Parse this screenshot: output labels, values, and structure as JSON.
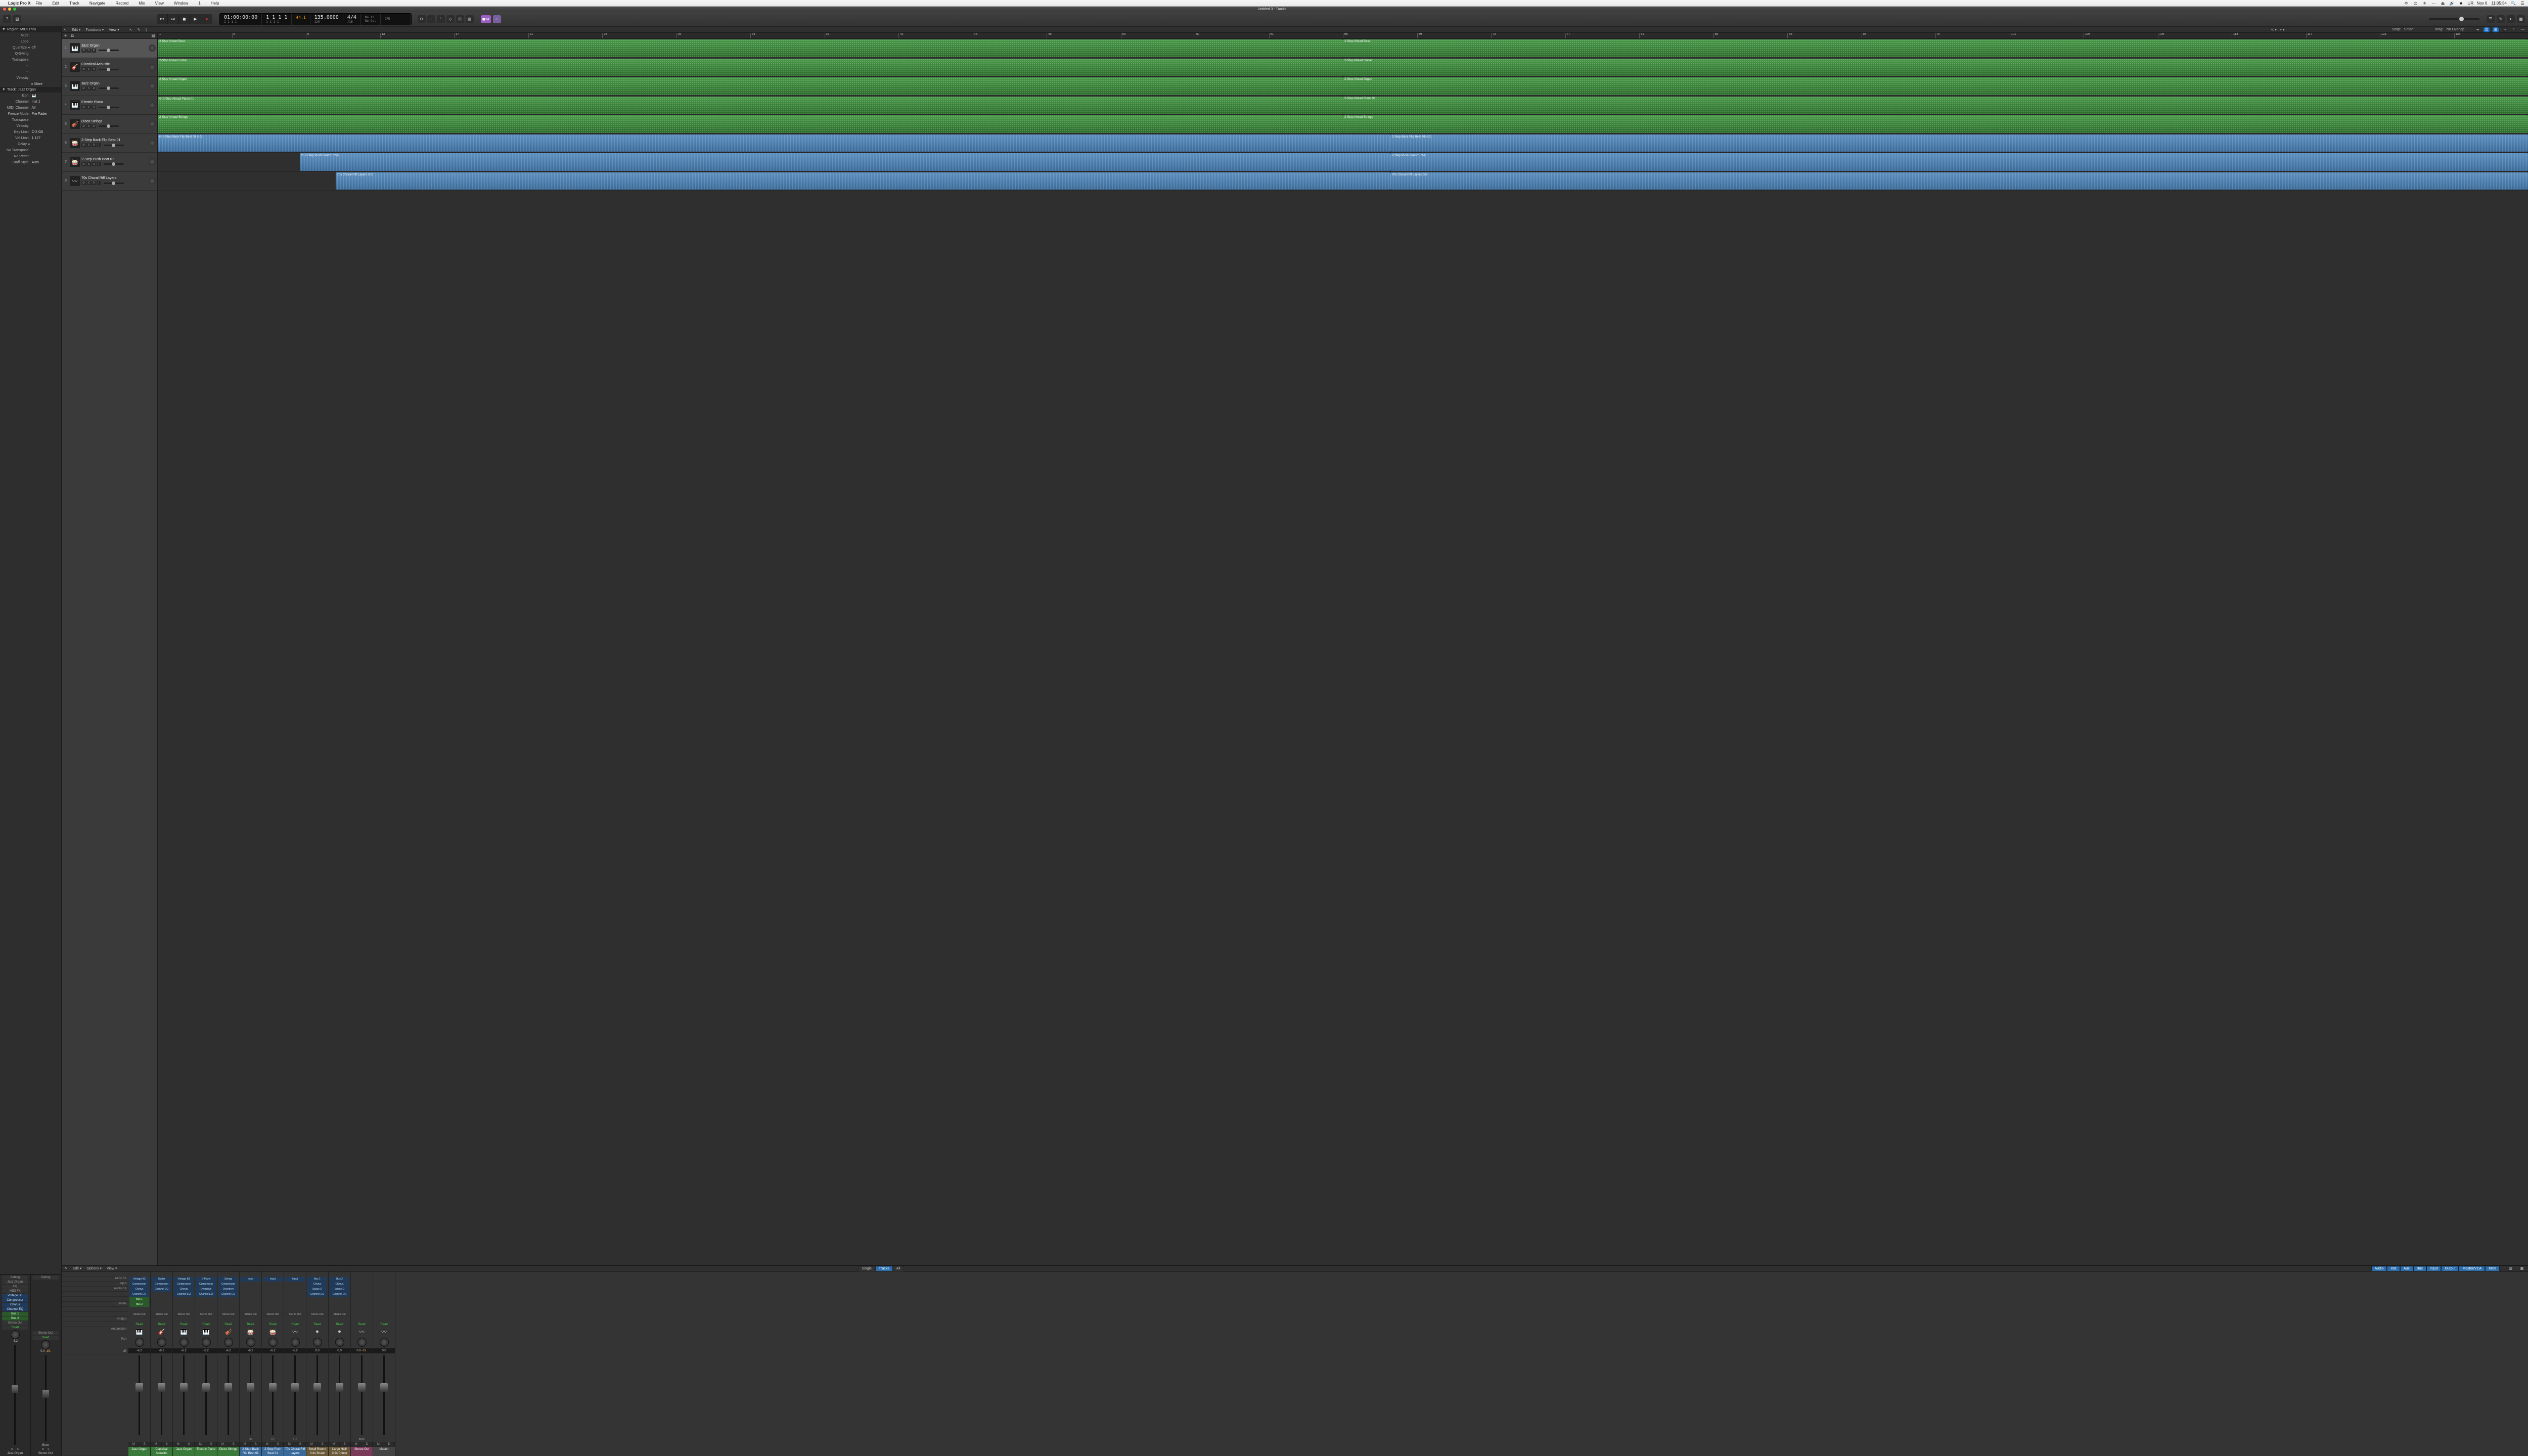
{
  "os": {
    "app_name": "Logic Pro X",
    "menus": [
      "File",
      "Edit",
      "Track",
      "Navigate",
      "Record",
      "Mix",
      "View",
      "Window",
      "1",
      "Help"
    ],
    "status_right": [
      "⟳",
      "◎",
      "✳",
      "⋯",
      "⏏",
      "🔊",
      "■",
      "UR"
    ],
    "date": "Nov 6",
    "time": "11:05:54",
    "window_title": "Untitled 3 - Tracks"
  },
  "transport": {
    "position": "01:00:00:00",
    "position_sub": "1  1  1  1",
    "bars_top": "1  1  1  1",
    "bars_bot": "1  1  1  1",
    "tempo_top": "44.1",
    "tempo": "135.0000",
    "tempo_sub": "129",
    "sig": "4/4",
    "sig_sub": "/16",
    "io_in": "No In",
    "io_out": "No Out",
    "cpu": "CPU",
    "notes_badge": "◼34"
  },
  "inspector": {
    "region_header": "Region: MIDI Thru",
    "region_rows": [
      {
        "lab": "Mute:",
        "val": ""
      },
      {
        "lab": "Loop:",
        "val": ""
      },
      {
        "lab": "Quantize ◂",
        "val": "off"
      },
      {
        "lab": "Q-Swing:",
        "val": ""
      },
      {
        "lab": "Transpose:",
        "val": ""
      },
      {
        "lab": "- :",
        "val": ""
      },
      {
        "lab": "- :",
        "val": ""
      },
      {
        "lab": "Velocity:",
        "val": ""
      },
      {
        "lab": "",
        "val": "▸ More"
      }
    ],
    "track_header": "Track: Jazz Organ",
    "track_rows": [
      {
        "lab": "Icon:",
        "val": "🎹"
      },
      {
        "lab": "Channel:",
        "val": "Inst 1"
      },
      {
        "lab": "MIDI Channel:",
        "val": "All"
      },
      {
        "lab": "Freeze Mode:",
        "val": "Pre Fader"
      },
      {
        "lab": "Transpose:",
        "val": ""
      },
      {
        "lab": "Velocity:",
        "val": ""
      },
      {
        "lab": "Key Limit:",
        "val": "C-2   G8"
      },
      {
        "lab": "Vel Limit:",
        "val": "1   127"
      },
      {
        "lab": "Delay ◂",
        "val": ""
      },
      {
        "lab": "No Transpose:",
        "val": ""
      },
      {
        "lab": "No Reset:",
        "val": ""
      },
      {
        "lab": "Staff Style:",
        "val": "Auto"
      }
    ],
    "chstrip1": {
      "name": "Jazz Organ",
      "setting": "Setting",
      "eq": "EQ",
      "midifx": "MIDI FX",
      "inst": "Vintage B3",
      "fx": [
        "Compressor",
        "Chorus",
        "Channel EQ"
      ],
      "sends": [
        "Bus 1",
        "Bus 2"
      ],
      "out": "Stereo Out",
      "auto": "Read",
      "db": "-6.2",
      "ms": [
        "M",
        "S"
      ]
    },
    "chstrip2": {
      "name": "Stereo Out",
      "setting": "Setting",
      "out": "Stereo Out",
      "bnce": "Bnce",
      "auto": "Read",
      "db": "0.0",
      "peak": "-19.",
      "ms": [
        "M",
        "S"
      ]
    }
  },
  "tracks_toolbar": {
    "menus": [
      "Edit",
      "Functions",
      "View"
    ],
    "snap_label": "Snap:",
    "snap": "Smart",
    "drag_label": "Drag:",
    "drag": "No Overlap"
  },
  "ruler_bars": [
    1,
    5,
    9,
    13,
    17,
    21,
    25,
    29,
    33,
    37,
    41,
    45,
    49,
    53,
    57,
    61,
    65,
    69,
    73,
    77,
    81,
    85,
    89,
    93,
    97,
    101,
    105,
    109,
    113,
    117,
    121,
    125
  ],
  "tracks": [
    {
      "num": 1,
      "name": "Jazz Organ",
      "icon": "🎹",
      "sel": true,
      "type": "midi",
      "regions": [
        {
          "name": "2-Step Ahead Bass",
          "start": 0,
          "len": 50
        },
        {
          "name": "2-Step Ahead Bass",
          "start": 50,
          "len": 50
        }
      ]
    },
    {
      "num": 2,
      "name": "Classical Acoustic",
      "icon": "🎸",
      "type": "midi",
      "regions": [
        {
          "name": "2-Step Ahead Guitar",
          "start": 0,
          "len": 50
        },
        {
          "name": "2-Step Ahead Guitar",
          "start": 50,
          "len": 50
        }
      ]
    },
    {
      "num": 3,
      "name": "Jazz Organ",
      "icon": "🎹",
      "type": "midi",
      "regions": [
        {
          "name": "2-Step Ahead Organ",
          "start": 0,
          "len": 50
        },
        {
          "name": "2-Step Ahead Organ",
          "start": 50,
          "len": 50
        }
      ]
    },
    {
      "num": 4,
      "name": "Electric Piano",
      "icon": "🎹",
      "type": "midi",
      "regions": [
        {
          "name": "⟳ 2-Step Ahead Piano 01",
          "start": 0,
          "len": 50
        },
        {
          "name": "2-Step Ahead Piano 01",
          "start": 50,
          "len": 50
        }
      ]
    },
    {
      "num": 5,
      "name": "Disco Strings",
      "icon": "🎻",
      "type": "midi",
      "regions": [
        {
          "name": "2-Step Ahead Strings",
          "start": 0,
          "len": 50
        },
        {
          "name": "2-Step Ahead Strings",
          "start": 50,
          "len": 50
        }
      ]
    },
    {
      "num": 6,
      "name": "2-Step Back Flip Beat 01",
      "icon": "🥁",
      "type": "audio",
      "regions": [
        {
          "name": "⟳ 2-Step Back Flip Beat 01  ⊙⊙",
          "start": 0,
          "len": 52
        },
        {
          "name": "2-Step Back Flip Beat 01  ⊙⊙",
          "start": 52,
          "len": 48
        }
      ]
    },
    {
      "num": 7,
      "name": "2-Step Push Beat 01",
      "icon": "🥁",
      "type": "audio",
      "regions": [
        {
          "name": "⟳ 2-Step Push Beat 01  ⊙⊙",
          "start": 6,
          "len": 46
        },
        {
          "name": "2-Step Push Beat 01  ⊙⊙",
          "start": 52,
          "len": 48
        }
      ]
    },
    {
      "num": 8,
      "name": "70s Choral Riff Layers",
      "icon": "〰",
      "type": "audio",
      "regions": [
        {
          "name": "70s Choral Riff Layers  ⊙⊙",
          "start": 7.5,
          "len": 44.5
        },
        {
          "name": "70s Choral Riff Layers  ⊙⊙",
          "start": 52,
          "len": 48
        }
      ]
    }
  ],
  "mixer_toolbar": {
    "menus": [
      "Edit",
      "Options",
      "View"
    ],
    "center": [
      "Single",
      "Tracks",
      "All"
    ],
    "right": [
      "Audio",
      "Inst",
      "Aux",
      "Bus",
      "Input",
      "Output",
      "Master/VCA",
      "MIDI"
    ]
  },
  "mixer_rowlabels": [
    "MIDI FX",
    "Input",
    "Audio FX",
    "",
    "",
    "Sends",
    "",
    "Group",
    "Output",
    "Automation",
    "",
    "",
    "Pan",
    "dB",
    "",
    "",
    "",
    "",
    "",
    "",
    "",
    "",
    ""
  ],
  "channels": [
    {
      "name": "Jazz Organ",
      "input": "Vintage B3",
      "fx": [
        "Compressor",
        "Chorus",
        "Channel EQ"
      ],
      "sends": [
        "Bus 1",
        "Bus 2"
      ],
      "out": "Stereo Out",
      "auto": "Read",
      "icon": "🎹",
      "db": "-6.2",
      "cn": "cn-green"
    },
    {
      "name": "Classical Acoustic",
      "input": "Guitar",
      "fx": [
        "Compressor",
        "Channel EQ"
      ],
      "out": "Stereo Out",
      "auto": "Read",
      "icon": "🎸",
      "db": "-6.2",
      "cn": "cn-green"
    },
    {
      "name": "Jazz Organ",
      "input": "Vintage B3",
      "fx": [
        "Compressor",
        "Chorus",
        "Channel EQ"
      ],
      "out": "Stereo Out",
      "auto": "Read",
      "icon": "🎹",
      "db": "-6.2",
      "cn": "cn-green"
    },
    {
      "name": "Electric Piano",
      "input": "E-Piano",
      "fx": [
        "Compressor",
        "Overdrive",
        "Channel EQ"
      ],
      "out": "Stereo Out",
      "auto": "Read",
      "icon": "🎹",
      "db": "-6.2",
      "cn": "cn-green"
    },
    {
      "name": "Disco Strings",
      "input": "Strings",
      "fx": [
        "Compressor",
        "Overdrive",
        "Channel EQ"
      ],
      "out": "Stereo Out",
      "auto": "Read",
      "icon": "🎻",
      "db": "-6.2",
      "cn": "cn-green"
    },
    {
      "name": "2-Step Back Flip Beat 01",
      "input": "Input",
      "ir": "I R",
      "out": "Stereo Out",
      "auto": "Read",
      "icon": "🥁",
      "db": "-6.2",
      "cn": "cn-blue"
    },
    {
      "name": "2-Step Push Beat 01",
      "input": "Input",
      "ir": "I R",
      "out": "Stereo Out",
      "auto": "Read",
      "icon": "🥁",
      "db": "-6.2",
      "cn": "cn-blue"
    },
    {
      "name": "70s Choral Riff Layers",
      "input": "Input",
      "ir": "I R",
      "out": "Stereo Out",
      "auto": "Read",
      "icon": "〰",
      "db": "-6.2",
      "cn": "cn-blue"
    },
    {
      "name": "Small Room/ 0.4s Snare Chamber",
      "input": "Bus 1",
      "fx": [
        "Chorus",
        "Space D",
        "Channel EQ"
      ],
      "out": "Stereo Out",
      "auto": "Read",
      "icon": "●",
      "db": "0.0",
      "cn": "cn-brown"
    },
    {
      "name": "Large Hall/ 3.9s Prince Hall One",
      "input": "Bus 2",
      "fx": [
        "Chorus",
        "Space D",
        "Channel EQ"
      ],
      "out": "Stereo Out",
      "auto": "Read",
      "icon": "●",
      "db": "0.0",
      "cn": "cn-brown"
    },
    {
      "name": "Stereo Out",
      "auto": "Read",
      "icon": "〰",
      "db": "0.0",
      "peak": "-19.",
      "bnce": "Bnce",
      "cn": "cn-purple",
      "md": "D"
    },
    {
      "name": "Master",
      "auto": "Read",
      "icon": "〰",
      "db": "0.0",
      "cn": "cn-gray",
      "md": "D"
    }
  ]
}
